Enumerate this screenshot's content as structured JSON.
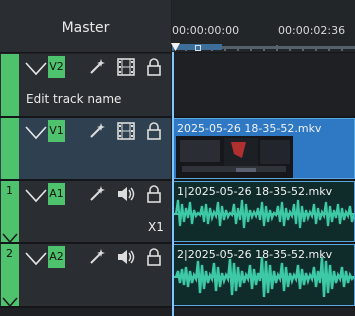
{
  "header": {
    "master_label": "Master",
    "tc_start": "00:00:00:00",
    "tc_end": "00:00:02:36"
  },
  "tracks": [
    {
      "name": "V2",
      "tooltip": "Edit track name"
    },
    {
      "name": "V1",
      "clip_label": "2025-05-26 18-35-52.mkv"
    },
    {
      "index": "1",
      "name": "A1",
      "clip_label": "1|2025-05-26 18-35-52.mkv",
      "target_label": "X1"
    },
    {
      "index": "2",
      "name": "A2",
      "clip_label": "2|2025-05-26 18-35-52.mkv"
    }
  ],
  "colors": {
    "track_green": "#4ec26d",
    "clip_blue": "#2f78c4",
    "waveform": "#3dc9a6",
    "selected_row": "#2f4150"
  }
}
